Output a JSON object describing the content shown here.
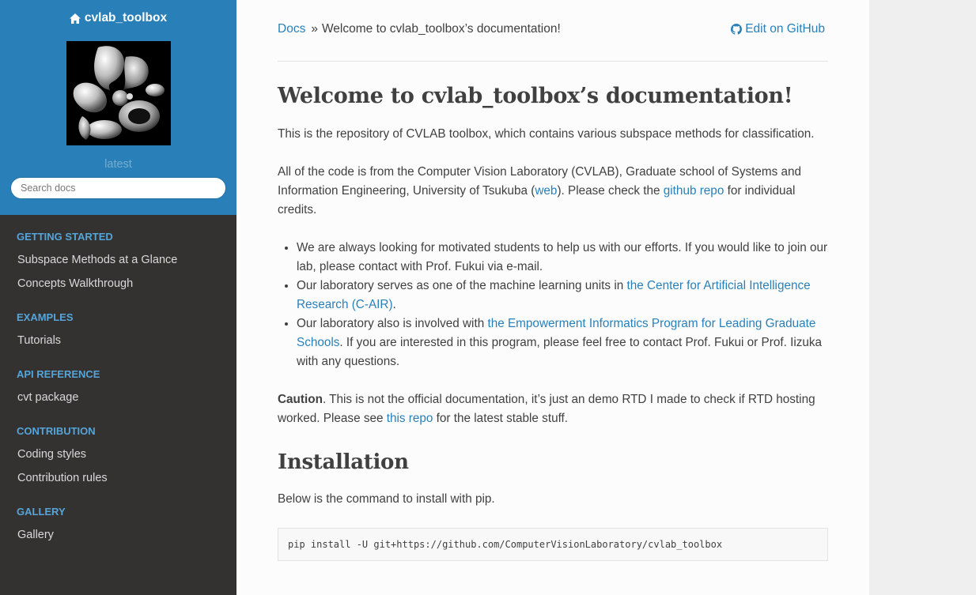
{
  "sidebar": {
    "project": "cvlab_toolbox",
    "version": "latest",
    "search_placeholder": "Search docs",
    "sections": [
      {
        "caption": "GETTING STARTED",
        "items": [
          "Subspace Methods at a Glance",
          "Concepts Walkthrough"
        ]
      },
      {
        "caption": "EXAMPLES",
        "items": [
          "Tutorials"
        ]
      },
      {
        "caption": "API REFERENCE",
        "items": [
          "cvt package"
        ]
      },
      {
        "caption": "CONTRIBUTION",
        "items": [
          "Coding styles",
          "Contribution rules"
        ]
      },
      {
        "caption": "GALLERY",
        "items": [
          "Gallery"
        ]
      }
    ]
  },
  "breadcrumbs": {
    "home": "Docs",
    "sep": "»",
    "current": "Welcome to cvlab_toolbox’s documentation!",
    "edit": "Edit on GitHub"
  },
  "main": {
    "title": "Welcome to cvlab_toolbox’s documentation!",
    "intro": "This is the repository of CVLAB toolbox, which contains various subspace methods for classification.",
    "p2": {
      "a": "All of the code is from the Computer Vision Laboratory (CVLAB), Graduate school of Systems and Information Engineering, University of Tsukuba (",
      "web": "web",
      "b": "). Please check the ",
      "repo": "github repo",
      "c": " for individual credits."
    },
    "bullets": {
      "b1": "We are always looking for motivated students to help us with our efforts. If you would like to join our lab, please contact with Prof. Fukui via e-mail.",
      "b2a": "Our laboratory serves as one of the machine learning units in ",
      "b2link": "the Center for Artificial Intelligence Research (C-AIR)",
      "b2b": ".",
      "b3a": "Our laboratory also is involved with ",
      "b3link": "the Empowerment Informatics Program for Leading Graduate Schools",
      "b3b": ". If you are interested in this program, please feel free to contact Prof. Fukui or Prof. Iizuka with any questions."
    },
    "caution": {
      "label": "Caution",
      "a": ". This is not the official documentation, it’s just an demo RTD I made to check if RTD hosting worked. Please see ",
      "link": "this repo",
      "b": " for the latest stable stuff."
    },
    "install_title": "Installation",
    "install_text": "Below is the command to install with pip.",
    "install_cmd": "pip install -U git+https://github.com/ComputerVisionLaboratory/cvlab_toolbox"
  },
  "colors": {
    "accent": "#2980b9",
    "sidebar_bg": "#343131",
    "caption": "#55a5d9"
  }
}
